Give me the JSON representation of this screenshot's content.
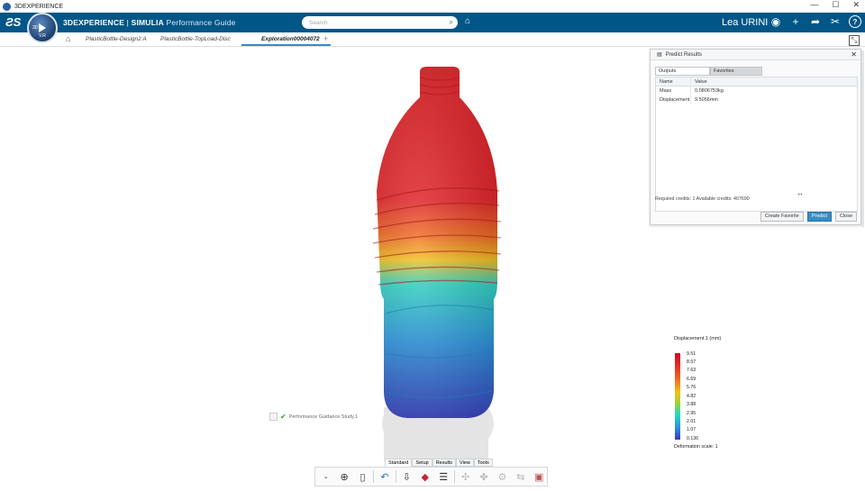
{
  "window": {
    "title": "3DEXPERIENCE",
    "controls": [
      "—",
      "☐",
      "✕"
    ]
  },
  "topbar": {
    "brand_3dx": "3DEXPERIENCE",
    "brand_sep": " | ",
    "brand_simulia": "SIMULIA",
    "app_name": "Performance Guide",
    "search_placeholder": "Search",
    "user_name": "Lea URINI",
    "compass_label": "3D",
    "compass_version": "V.R"
  },
  "tabs": [
    {
      "label": "PlasticBottle-Design2 A"
    },
    {
      "label": "PlasticBottle-TopLoad-Disc"
    },
    {
      "label": "Exploration00004072"
    }
  ],
  "predict_panel": {
    "title": "Predict Results",
    "tabs": [
      "Outputs",
      "Favorites"
    ],
    "columns": [
      "Name",
      "Value"
    ],
    "rows": [
      {
        "name": "Mass",
        "value": "0.0806753kg"
      },
      {
        "name": "Displacement",
        "value": "9.5056mm"
      }
    ],
    "credits": "Required credits:  1    Available credits: 407690",
    "buttons": {
      "favorite": "Create Favorite",
      "predict": "Predict",
      "close": "Close"
    }
  },
  "legend": {
    "title": "Displacement.1 (mm)",
    "ticks": [
      "9.51",
      "8.57",
      "7.63",
      "6.69",
      "5.76",
      "4.82",
      "3.88",
      "2.95",
      "2.01",
      "1.07",
      "0.136"
    ],
    "deformation_scale": "Deformation scale: 1",
    "colors": [
      "#c8102e",
      "#e6232a",
      "#ee6a1c",
      "#f4c21a",
      "#9ad336",
      "#23d6c9",
      "#2d8fe0",
      "#3a37b4"
    ]
  },
  "study_label": "Performance Guidance Study.1",
  "section_tabs": [
    "Standard",
    "Setup",
    "Results",
    "View",
    "Tools"
  ],
  "accent": "#005686"
}
